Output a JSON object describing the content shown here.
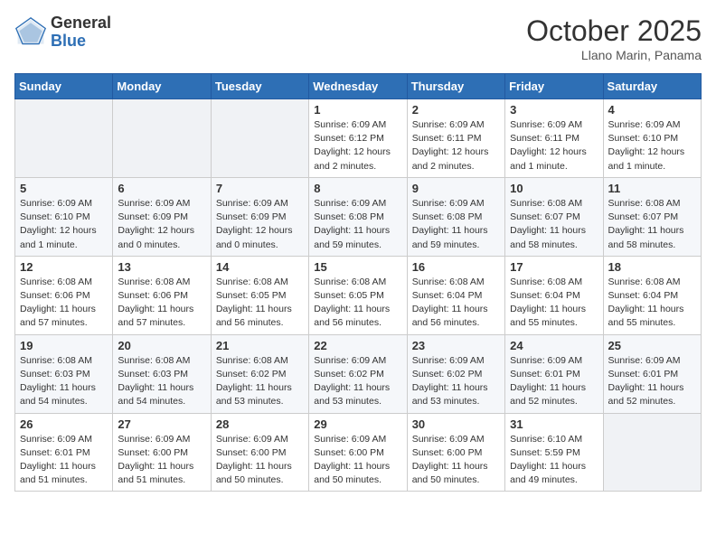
{
  "header": {
    "logo": {
      "general": "General",
      "blue": "Blue"
    },
    "month": "October 2025",
    "location": "Llano Marin, Panama"
  },
  "days_of_week": [
    "Sunday",
    "Monday",
    "Tuesday",
    "Wednesday",
    "Thursday",
    "Friday",
    "Saturday"
  ],
  "weeks": [
    [
      {
        "day": "",
        "info": ""
      },
      {
        "day": "",
        "info": ""
      },
      {
        "day": "",
        "info": ""
      },
      {
        "day": "1",
        "info": "Sunrise: 6:09 AM\nSunset: 6:12 PM\nDaylight: 12 hours\nand 2 minutes."
      },
      {
        "day": "2",
        "info": "Sunrise: 6:09 AM\nSunset: 6:11 PM\nDaylight: 12 hours\nand 2 minutes."
      },
      {
        "day": "3",
        "info": "Sunrise: 6:09 AM\nSunset: 6:11 PM\nDaylight: 12 hours\nand 1 minute."
      },
      {
        "day": "4",
        "info": "Sunrise: 6:09 AM\nSunset: 6:10 PM\nDaylight: 12 hours\nand 1 minute."
      }
    ],
    [
      {
        "day": "5",
        "info": "Sunrise: 6:09 AM\nSunset: 6:10 PM\nDaylight: 12 hours\nand 1 minute."
      },
      {
        "day": "6",
        "info": "Sunrise: 6:09 AM\nSunset: 6:09 PM\nDaylight: 12 hours\nand 0 minutes."
      },
      {
        "day": "7",
        "info": "Sunrise: 6:09 AM\nSunset: 6:09 PM\nDaylight: 12 hours\nand 0 minutes."
      },
      {
        "day": "8",
        "info": "Sunrise: 6:09 AM\nSunset: 6:08 PM\nDaylight: 11 hours\nand 59 minutes."
      },
      {
        "day": "9",
        "info": "Sunrise: 6:09 AM\nSunset: 6:08 PM\nDaylight: 11 hours\nand 59 minutes."
      },
      {
        "day": "10",
        "info": "Sunrise: 6:08 AM\nSunset: 6:07 PM\nDaylight: 11 hours\nand 58 minutes."
      },
      {
        "day": "11",
        "info": "Sunrise: 6:08 AM\nSunset: 6:07 PM\nDaylight: 11 hours\nand 58 minutes."
      }
    ],
    [
      {
        "day": "12",
        "info": "Sunrise: 6:08 AM\nSunset: 6:06 PM\nDaylight: 11 hours\nand 57 minutes."
      },
      {
        "day": "13",
        "info": "Sunrise: 6:08 AM\nSunset: 6:06 PM\nDaylight: 11 hours\nand 57 minutes."
      },
      {
        "day": "14",
        "info": "Sunrise: 6:08 AM\nSunset: 6:05 PM\nDaylight: 11 hours\nand 56 minutes."
      },
      {
        "day": "15",
        "info": "Sunrise: 6:08 AM\nSunset: 6:05 PM\nDaylight: 11 hours\nand 56 minutes."
      },
      {
        "day": "16",
        "info": "Sunrise: 6:08 AM\nSunset: 6:04 PM\nDaylight: 11 hours\nand 56 minutes."
      },
      {
        "day": "17",
        "info": "Sunrise: 6:08 AM\nSunset: 6:04 PM\nDaylight: 11 hours\nand 55 minutes."
      },
      {
        "day": "18",
        "info": "Sunrise: 6:08 AM\nSunset: 6:04 PM\nDaylight: 11 hours\nand 55 minutes."
      }
    ],
    [
      {
        "day": "19",
        "info": "Sunrise: 6:08 AM\nSunset: 6:03 PM\nDaylight: 11 hours\nand 54 minutes."
      },
      {
        "day": "20",
        "info": "Sunrise: 6:08 AM\nSunset: 6:03 PM\nDaylight: 11 hours\nand 54 minutes."
      },
      {
        "day": "21",
        "info": "Sunrise: 6:08 AM\nSunset: 6:02 PM\nDaylight: 11 hours\nand 53 minutes."
      },
      {
        "day": "22",
        "info": "Sunrise: 6:09 AM\nSunset: 6:02 PM\nDaylight: 11 hours\nand 53 minutes."
      },
      {
        "day": "23",
        "info": "Sunrise: 6:09 AM\nSunset: 6:02 PM\nDaylight: 11 hours\nand 53 minutes."
      },
      {
        "day": "24",
        "info": "Sunrise: 6:09 AM\nSunset: 6:01 PM\nDaylight: 11 hours\nand 52 minutes."
      },
      {
        "day": "25",
        "info": "Sunrise: 6:09 AM\nSunset: 6:01 PM\nDaylight: 11 hours\nand 52 minutes."
      }
    ],
    [
      {
        "day": "26",
        "info": "Sunrise: 6:09 AM\nSunset: 6:01 PM\nDaylight: 11 hours\nand 51 minutes."
      },
      {
        "day": "27",
        "info": "Sunrise: 6:09 AM\nSunset: 6:00 PM\nDaylight: 11 hours\nand 51 minutes."
      },
      {
        "day": "28",
        "info": "Sunrise: 6:09 AM\nSunset: 6:00 PM\nDaylight: 11 hours\nand 50 minutes."
      },
      {
        "day": "29",
        "info": "Sunrise: 6:09 AM\nSunset: 6:00 PM\nDaylight: 11 hours\nand 50 minutes."
      },
      {
        "day": "30",
        "info": "Sunrise: 6:09 AM\nSunset: 6:00 PM\nDaylight: 11 hours\nand 50 minutes."
      },
      {
        "day": "31",
        "info": "Sunrise: 6:10 AM\nSunset: 5:59 PM\nDaylight: 11 hours\nand 49 minutes."
      },
      {
        "day": "",
        "info": ""
      }
    ]
  ]
}
